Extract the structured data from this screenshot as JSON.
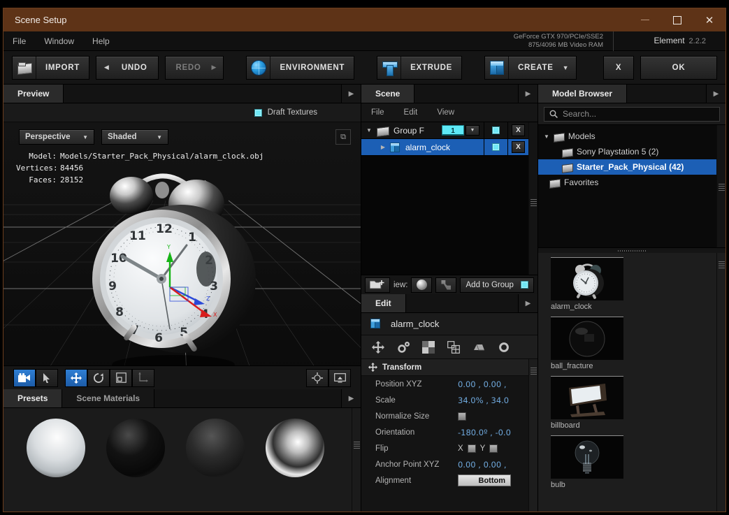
{
  "window": {
    "title": "Scene Setup",
    "minimize_icon": "minimize-icon",
    "maximize_icon": "maximize-icon",
    "close_icon": "close-icon"
  },
  "menubar": {
    "items": [
      "File",
      "Window",
      "Help"
    ],
    "gpu_line1": "GeForce GTX 970/PCIe/SSE2",
    "gpu_line2": "875/4096 MB Video RAM",
    "brand": "Element",
    "version": "2.2.2"
  },
  "toolbar": {
    "import": "IMPORT",
    "undo": "UNDO",
    "redo": "REDO",
    "environment": "ENVIRONMENT",
    "extrude": "EXTRUDE",
    "create": "CREATE",
    "cancel": "X",
    "ok": "OK",
    "undo_arrow": "◀",
    "redo_arrow": "▶",
    "create_arrow": "▼"
  },
  "preview": {
    "tab": "Preview",
    "draft_textures": "Draft Textures",
    "projection": "Perspective",
    "shading": "Shaded",
    "model_key": "Model:",
    "model_value": "Models/Starter_Pack_Physical/alarm_clock.obj",
    "vertices_key": "Vertices:",
    "vertices_value": "84456",
    "faces_key": "Faces:",
    "faces_value": "28152",
    "dropdown_caret": "▼",
    "expand_icon": "expand-icon"
  },
  "viewport_tools": {
    "camera": "camera-icon",
    "select": "cursor-icon",
    "move": "move-icon",
    "rotate": "rotate-icon",
    "scale": "scale-icon",
    "axis": "axis-icon",
    "center": "center-target-icon",
    "screen": "screen-icon"
  },
  "presets": {
    "tabs": [
      "Presets",
      "Scene Materials"
    ],
    "active_tab": "Presets",
    "items": [
      {
        "name": "matte-white-sphere",
        "label": ""
      },
      {
        "name": "black-glossy-sphere",
        "label": ""
      },
      {
        "name": "dark-glass-sphere",
        "label": ""
      },
      {
        "name": "chrome-sphere",
        "label": ""
      }
    ]
  },
  "scene": {
    "tab": "Scene",
    "menu": [
      "File",
      "Edit",
      "View"
    ],
    "rows": [
      {
        "name": "Group F",
        "type": "group",
        "count": "1",
        "expanded": true,
        "visible": true,
        "delete": "X",
        "selected": false
      },
      {
        "name": "alarm_clock",
        "type": "model",
        "expanded": false,
        "visible": true,
        "delete": "X",
        "selected": true
      }
    ],
    "bottom": {
      "new_group_icon": "new-group-icon",
      "view_label": "iew:",
      "sphere_icon": "sphere-preview-icon",
      "grid_icon": "grid-preview-icon",
      "add_to_group": "Add to Group"
    }
  },
  "edit": {
    "tab": "Edit",
    "object_name": "alarm_clock",
    "icons": [
      "transform-icon",
      "gears-icon",
      "checker-icon",
      "group-icon",
      "mesh-icon",
      "settings-gear-icon"
    ],
    "section": "Transform",
    "properties": [
      {
        "label": "Position XYZ",
        "value": "0.00 ,  0.00 ,",
        "kind": "link"
      },
      {
        "label": "Scale",
        "value": "34.0% ,  34.0",
        "kind": "link"
      },
      {
        "label": "Normalize Size",
        "value": "",
        "kind": "checkbox"
      },
      {
        "label": "Orientation",
        "value": "-180.0º ,  -0.0",
        "kind": "link"
      },
      {
        "label": "Flip",
        "value": "",
        "kind": "flip",
        "x": "X",
        "y": "Y"
      },
      {
        "label": "Anchor Point XYZ",
        "value": "0.00 ,  0.00 ,",
        "kind": "link"
      },
      {
        "label": "Alignment",
        "value": "Bottom",
        "kind": "button"
      }
    ]
  },
  "model_browser": {
    "tab": "Model Browser",
    "search_placeholder": "Search...",
    "search_value": "",
    "search_icon": "search-icon",
    "tree": [
      {
        "label": "Models",
        "indent": 0,
        "expanded": true,
        "selected": false
      },
      {
        "label": "Sony Playstation 5 (2)",
        "indent": 1,
        "selected": false
      },
      {
        "label": "Starter_Pack_Physical (42)",
        "indent": 1,
        "selected": true
      },
      {
        "label": "Favorites",
        "indent": 0,
        "selected": false
      }
    ],
    "thumbnails": [
      {
        "caption": "alarm_clock",
        "kind": "clock"
      },
      {
        "caption": "ball_fracture",
        "kind": "ball"
      },
      {
        "caption": "billboard",
        "kind": "billboard"
      },
      {
        "caption": "bulb",
        "kind": "bulb"
      }
    ]
  },
  "colors": {
    "titlebar": "#5e3317",
    "accent_selection": "#1c5fb5",
    "cyan_checkbox": "#6fe8f5",
    "link_value": "#6fa8dc"
  }
}
